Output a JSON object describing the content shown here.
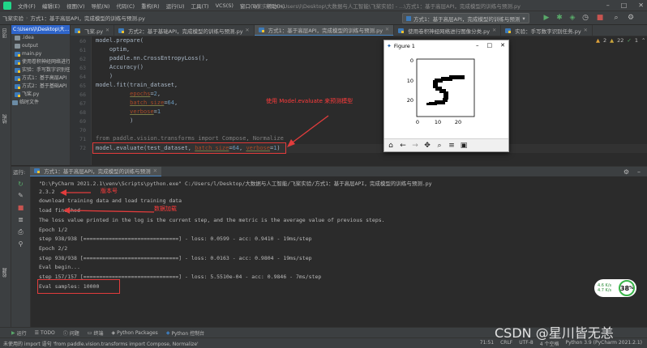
{
  "menubar": {
    "items": [
      "文件(F)",
      "编辑(E)",
      "视图(V)",
      "导航(N)",
      "代码(C)",
      "重构(R)",
      "运行(U)",
      "工具(T)",
      "VCS(S)",
      "窗口(W)",
      "帮助(H)"
    ],
    "window_title": "飞桨实验 [C:\\Users\\l\\Desktop\\大数据与人工智能\\飞桨实验] - ...\\方式1：基于高层API，完成模型的训练与预测.py"
  },
  "navbar": {
    "crumbs": [
      "飞桨实验",
      "方式1：基于高层API，完成模型的训练与预测.py"
    ],
    "run_config": "方式1：基于高层API，完成模型的训练与预测"
  },
  "left_stripe": {
    "project_label": "项目",
    "structure_label": "结构",
    "favorites_label": "收藏"
  },
  "project": {
    "root": "C:\\Users\\l\\Desktop\\大...",
    "items": [
      {
        "label": ".idea",
        "icon": "folder"
      },
      {
        "label": "output",
        "icon": "folder"
      },
      {
        "label": "main.py",
        "icon": "py"
      },
      {
        "label": "使用卷积神经网络进行",
        "icon": "py"
      },
      {
        "label": "实验：手写数字识别任",
        "icon": "py"
      },
      {
        "label": "方式1：基于高层API",
        "icon": "py"
      },
      {
        "label": "方式2：基于基础API",
        "icon": "py"
      },
      {
        "label": "飞桨.py",
        "icon": "py"
      },
      {
        "label": "临时文件",
        "icon": "lib"
      }
    ]
  },
  "tabs": [
    {
      "label": "飞桨.py",
      "active": false
    },
    {
      "label": "方式2：基于基础API，完成模型的训练与预测.py",
      "active": false
    },
    {
      "label": "方式1：基于高层API，完成模型的训练与预测.py",
      "active": true
    },
    {
      "label": "使用卷积神经网络进行图像分类.py",
      "active": false
    },
    {
      "label": "实验：手写数字识别任务.py",
      "active": false
    }
  ],
  "inspections": {
    "warnings": "2",
    "weak_warnings": "22",
    "typos": "1"
  },
  "editor": {
    "line_numbers": [
      "60",
      "61",
      "62",
      "63",
      "64",
      "65",
      "66",
      "67",
      "68",
      "69",
      "70",
      "71",
      "72"
    ],
    "lines": {
      "l60": "model.prepare(",
      "l61": "    optim,",
      "l62": "    paddle.nn.CrossEntropyLoss(),",
      "l63": "    Accuracy()",
      "l64": "    )",
      "l65_a": "model.fit(train_dataset,",
      "l66_kw": "epochs",
      "l66_val": "2",
      "l67_kw": "batch_size",
      "l67_val": "64",
      "l68_kw": "verbose",
      "l68_val": "1",
      "l69": "    )",
      "l71": "from paddle.vision.transforms import Compose, Normalize",
      "l72_a": "model.evaluate(test_dataset, ",
      "l72_kw1": "batch_size",
      "l72_v1": "64",
      "l72_kw2": "verbose",
      "l72_v2": "1",
      "l72_b": ")"
    },
    "annotation": "使用 Model.evaluate 来预测模型"
  },
  "figure": {
    "title": "Figure 1",
    "x_ticks": [
      "0",
      "10",
      "20"
    ],
    "y_ticks": [
      "0",
      "10",
      "20"
    ]
  },
  "run_panel": {
    "label": "运行:",
    "tab": "方式1：基于高层API，完成模型的训练与预测",
    "lines": [
      "\"D:\\PyCharm 2021.2.1\\venv\\Scripts\\python.exe\" C:/Users/l/Desktop/大数据与人工智能/飞桨实验/方式1：基于高层API，完成模型的训练与预测.py",
      "2.3.2",
      "download training data and load training data",
      "load finished",
      "The loss value printed in the log is the current step, and the metric is the average value of previous steps.",
      "Epoch 1/2",
      "step 938/938 [==============================] - loss: 0.0599 - acc: 0.9410 - 19ms/step",
      "Epoch 2/2",
      "step 938/938 [==============================] - loss: 0.0163 - acc: 0.9804 - 19ms/step",
      "Eval begin...",
      "step 157/157 [==============================] - loss: 5.5510e-04 - acc: 0.9846 - 7ms/step",
      "Eval samples: 10000"
    ],
    "annot_version": "版本号",
    "annot_data": "数据加载"
  },
  "bottombar": {
    "items": [
      "运行",
      "TODO",
      "问题",
      "终端",
      "Python Packages",
      "Python 控制台"
    ]
  },
  "statusbar": {
    "message": "未使用的 import 语句 'from paddle.vision.transforms import Compose, Normalize'",
    "position": "71:51",
    "line_sep": "CRLF",
    "encoding": "UTF-8",
    "indent": "4 个空格",
    "interpreter": "Python 3.9 (PyCharm 2021.2.1)"
  },
  "net_widget": {
    "up": "4.6 K/s",
    "down": "4.7 K/s",
    "percent": "38",
    "percent_sign": "%"
  },
  "watermark": "CSDN @星川皆无恙",
  "colors": {
    "accent": "#4a88c7",
    "annotation_red": "#ff3b3b",
    "keyword": "#cc7832",
    "param": "#aa4926",
    "number": "#6897bb"
  }
}
